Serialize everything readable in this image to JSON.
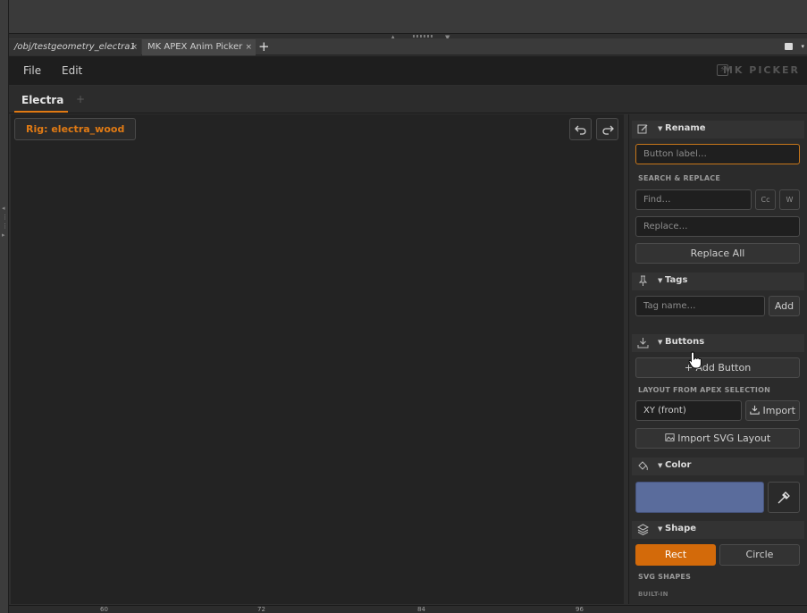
{
  "pane_tabs": [
    {
      "label": "/obj/testgeometry_electra1",
      "close": "×"
    },
    {
      "label": "MK APEX Anim Picker",
      "close": "×"
    }
  ],
  "pane_tab_add": "+",
  "menu": {
    "file": "File",
    "edit": "Edit"
  },
  "brand": "MK PICKER",
  "tabs": {
    "active": "Electra",
    "add": "+"
  },
  "rig_badge": "Rig: electra_wood",
  "rename": {
    "title": "Rename",
    "label_placeholder": "Button label…",
    "search_replace_label": "SEARCH & REPLACE",
    "find_placeholder": "Find…",
    "case_btn": "Cc",
    "word_btn": "W",
    "replace_placeholder": "Replace…",
    "replace_all": "Replace All"
  },
  "tags": {
    "title": "Tags",
    "placeholder": "Tag name…",
    "add": "Add"
  },
  "buttons": {
    "title": "Buttons",
    "add_button": "+ Add Button",
    "layout_label": "LAYOUT FROM APEX SELECTION",
    "view_select": "XY  (front)",
    "import": "Import",
    "import_svg": "Import SVG Layout"
  },
  "color": {
    "title": "Color",
    "swatch": "#5a6c9c",
    "accent": "#e07a14"
  },
  "shape": {
    "title": "Shape",
    "rect": "Rect",
    "circle": "Circle",
    "svg_shapes_label": "SVG SHAPES",
    "builtin_label": "BUILT-IN"
  },
  "ruler": [
    "60",
    "72",
    "84",
    "96"
  ]
}
